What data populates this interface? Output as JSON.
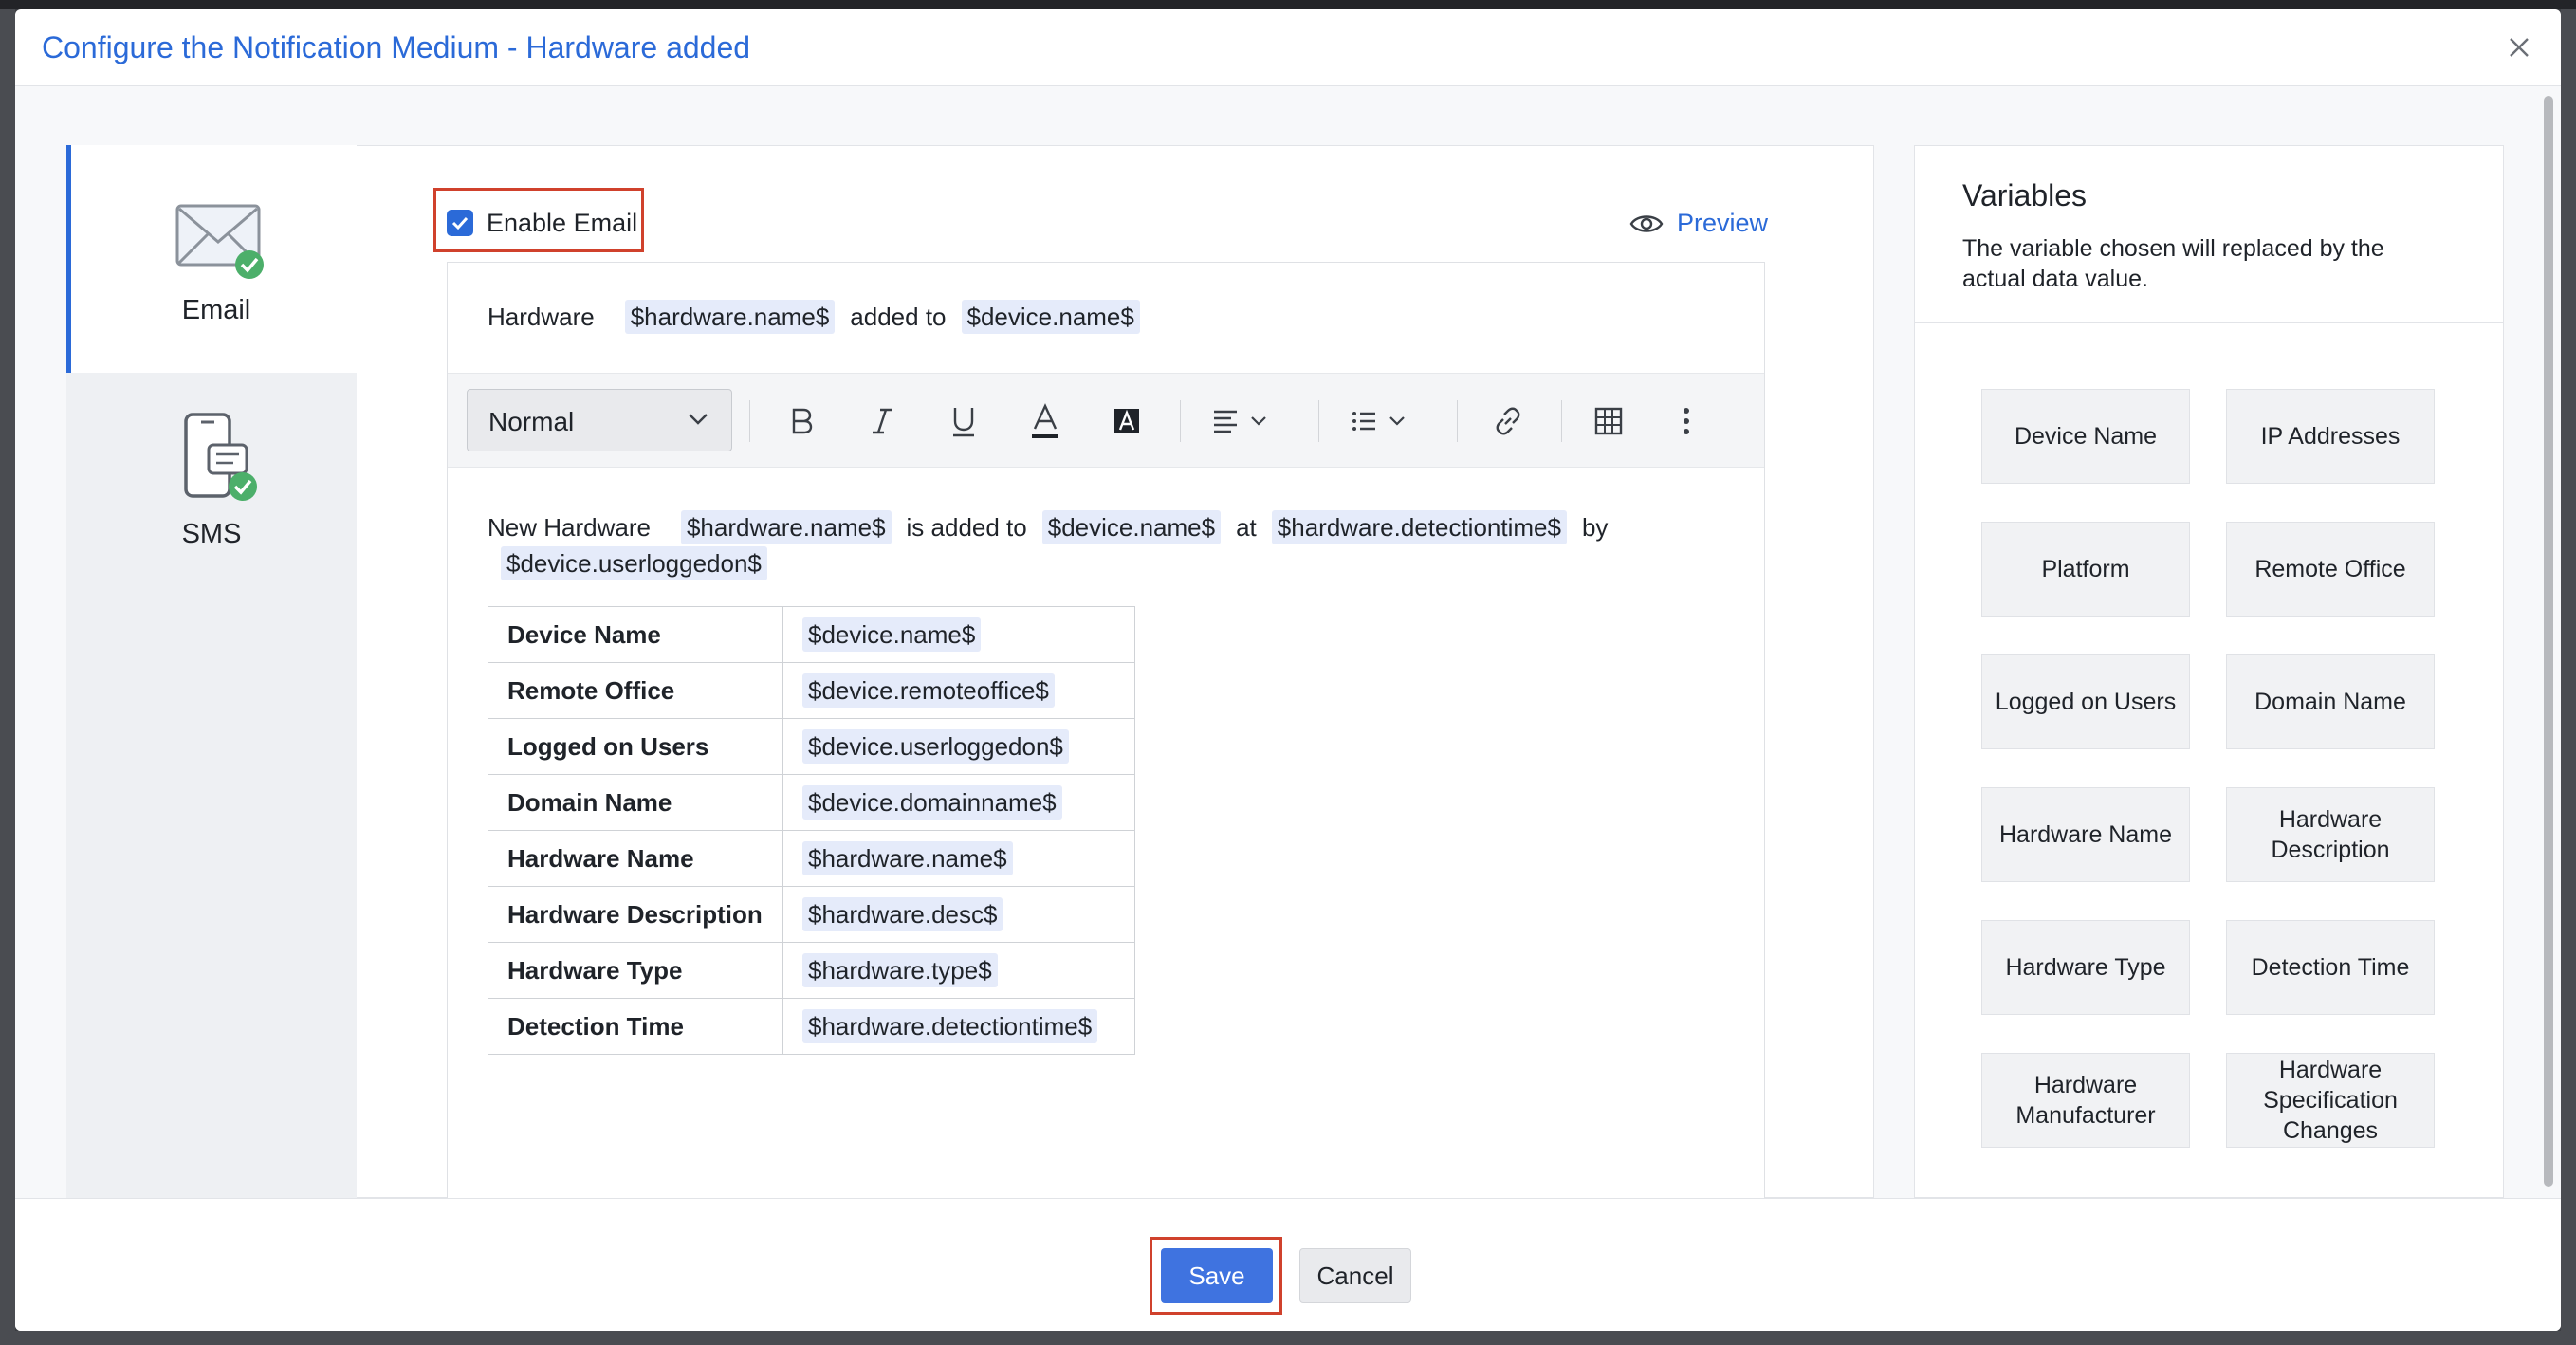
{
  "dialog": {
    "title": "Configure the Notification Medium - Hardware added"
  },
  "nav": {
    "items": [
      {
        "label": "Email",
        "icon": "email-icon",
        "active": true
      },
      {
        "label": "SMS",
        "icon": "sms-icon",
        "active": false
      }
    ]
  },
  "email": {
    "enable_label": "Enable Email",
    "enabled": true,
    "preview_label": "Preview",
    "subject": {
      "parts": [
        "Hardware",
        "$hardware.name$",
        "added to",
        "$device.name$"
      ]
    },
    "toolbar": {
      "format_value": "Normal",
      "buttons": [
        "bold-icon",
        "italic-icon",
        "underline-icon",
        "font-color-icon",
        "highlight-icon",
        "align-icon",
        "list-icon",
        "link-icon",
        "table-icon",
        "more-icon"
      ]
    },
    "body": {
      "line1": [
        "New Hardware",
        "$hardware.name$",
        "is added to",
        "$device.name$",
        "at",
        "$hardware.detectiontime$",
        "by"
      ],
      "line2": [
        "$device.userloggedon$"
      ],
      "table": [
        {
          "key": "Device Name",
          "value": "$device.name$"
        },
        {
          "key": "Remote Office",
          "value": "$device.remoteoffice$"
        },
        {
          "key": "Logged on Users",
          "value": "$device.userloggedon$"
        },
        {
          "key": "Domain Name",
          "value": "$device.domainname$"
        },
        {
          "key": "Hardware Name",
          "value": "$hardware.name$"
        },
        {
          "key": "Hardware Description",
          "value": "$hardware.desc$"
        },
        {
          "key": "Hardware Type",
          "value": "$hardware.type$"
        },
        {
          "key": "Detection Time",
          "value": "$hardware.detectiontime$"
        }
      ]
    }
  },
  "variables": {
    "title": "Variables",
    "description": "The variable chosen will replaced by the actual data value.",
    "buttons": [
      "Device Name",
      "IP Addresses",
      "Platform",
      "Remote Office",
      "Logged on Users",
      "Domain Name",
      "Hardware Name",
      "Hardware Description",
      "Hardware Type",
      "Detection Time",
      "Hardware Manufacturer",
      "Hardware Specification Changes"
    ]
  },
  "footer": {
    "save_label": "Save",
    "cancel_label": "Cancel"
  },
  "colors": {
    "accent": "#2b6ad8",
    "save_button": "#3f73e0",
    "highlight_outline": "#d0412c",
    "variable_chip": "#e5ebfa",
    "success_badge": "#4caf6a"
  }
}
